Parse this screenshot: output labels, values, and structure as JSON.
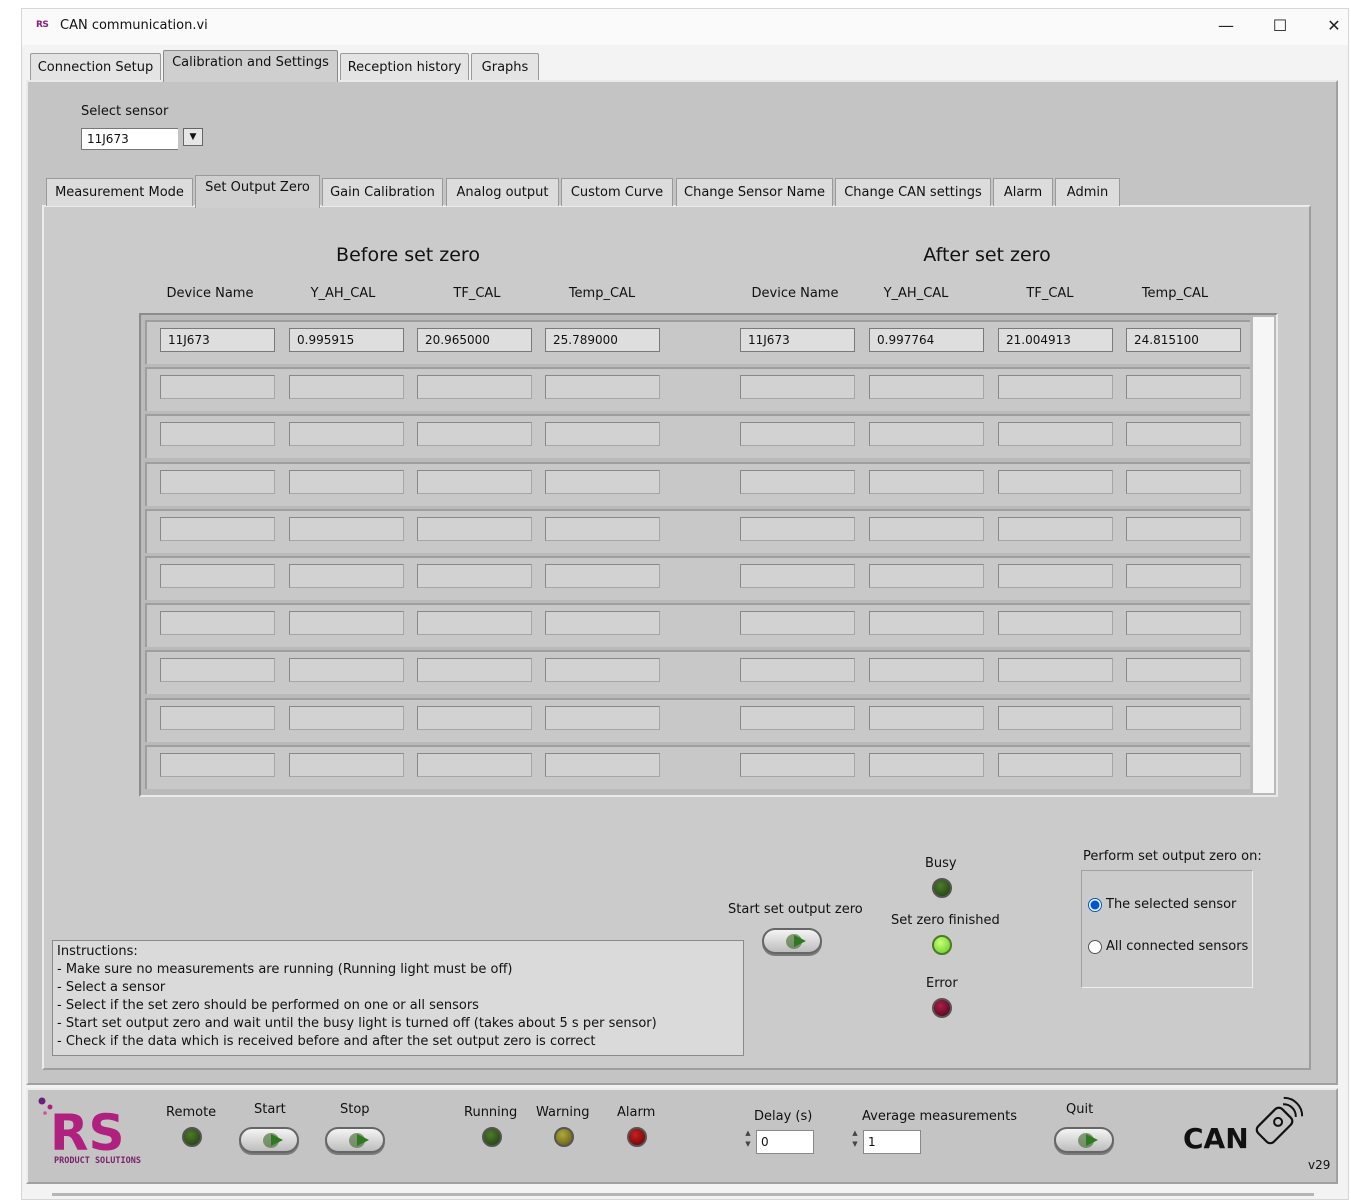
{
  "window": {
    "app_icon": "RS",
    "title": "CAN communication.vi",
    "minimize_glyph": "—",
    "maximize_glyph": "☐",
    "close_glyph": "✕"
  },
  "main_tabs": [
    {
      "label": "Connection Setup"
    },
    {
      "label": "Calibration and Settings"
    },
    {
      "label": "Reception history"
    },
    {
      "label": "Graphs"
    }
  ],
  "active_main_tab": "Calibration and Settings",
  "sensor_select": {
    "label": "Select sensor",
    "value": "11J673"
  },
  "sub_tabs": [
    {
      "label": "Measurement Mode"
    },
    {
      "label": "Set Output Zero"
    },
    {
      "label": "Gain Calibration"
    },
    {
      "label": "Analog output"
    },
    {
      "label": "Custom Curve"
    },
    {
      "label": "Change Sensor Name"
    },
    {
      "label": "Change CAN settings"
    },
    {
      "label": "Alarm"
    },
    {
      "label": "Admin"
    }
  ],
  "active_sub_tab": "Set Output Zero",
  "before": {
    "title": "Before set zero",
    "columns": [
      "Device Name",
      "Y_AH_CAL",
      "TF_CAL",
      "Temp_CAL"
    ]
  },
  "after": {
    "title": "After set zero",
    "columns": [
      "Device Name",
      "Y_AH_CAL",
      "TF_CAL",
      "Temp_CAL"
    ]
  },
  "rows": [
    {
      "before": [
        "11J673",
        "0.995915",
        "20.965000",
        "25.789000"
      ],
      "after": [
        "11J673",
        "0.997764",
        "21.004913",
        "24.815100"
      ]
    },
    {
      "before": [
        "",
        "",
        "",
        ""
      ],
      "after": [
        "",
        "",
        "",
        ""
      ]
    },
    {
      "before": [
        "",
        "",
        "",
        ""
      ],
      "after": [
        "",
        "",
        "",
        ""
      ]
    },
    {
      "before": [
        "",
        "",
        "",
        ""
      ],
      "after": [
        "",
        "",
        "",
        ""
      ]
    },
    {
      "before": [
        "",
        "",
        "",
        ""
      ],
      "after": [
        "",
        "",
        "",
        ""
      ]
    },
    {
      "before": [
        "",
        "",
        "",
        ""
      ],
      "after": [
        "",
        "",
        "",
        ""
      ]
    },
    {
      "before": [
        "",
        "",
        "",
        ""
      ],
      "after": [
        "",
        "",
        "",
        ""
      ]
    },
    {
      "before": [
        "",
        "",
        "",
        ""
      ],
      "after": [
        "",
        "",
        "",
        ""
      ]
    },
    {
      "before": [
        "",
        "",
        "",
        ""
      ],
      "after": [
        "",
        "",
        "",
        ""
      ]
    },
    {
      "before": [
        "",
        "",
        "",
        ""
      ],
      "after": [
        "",
        "",
        "",
        ""
      ]
    }
  ],
  "controls": {
    "start_set_zero_label": "Start set output zero",
    "busy_label": "Busy",
    "finished_label": "Set zero finished",
    "error_label": "Error",
    "busy_on": false,
    "finished_on": true,
    "error_on": false
  },
  "perform_on": {
    "label": "Perform set output zero on:",
    "options": [
      "The selected sensor",
      "All connected sensors"
    ],
    "selected": "The selected sensor"
  },
  "instructions": {
    "title": "Instructions:",
    "lines": [
      "- Make sure no measurements are running (Running light must be off)",
      "- Select a sensor",
      "- Select if the set zero should be performed on one or all sensors",
      "- Start set output zero and wait until the busy light is turned off (takes about 5 s per sensor)",
      "- Check if the data which is received before and after the set output zero is correct"
    ]
  },
  "bottom": {
    "logo_text": "RS",
    "logo_sub": "PRODUCT SOLUTIONS",
    "remote_label": "Remote",
    "start_label": "Start",
    "stop_label": "Stop",
    "running_label": "Running",
    "warning_label": "Warning",
    "alarm_label": "Alarm",
    "delay_label": "Delay (s)",
    "delay_value": "0",
    "average_label": "Average measurements",
    "average_value": "1",
    "quit_label": "Quit",
    "can_logo": "CAN",
    "version": "v29"
  },
  "colors": {
    "panel": "#c4c4c4",
    "led_green_on": "#7ee02c",
    "led_green_off": "#2e5518",
    "led_red_off": "#7a0020",
    "radio_selected": "#0058c8",
    "logo_magenta": "#b0207e"
  }
}
